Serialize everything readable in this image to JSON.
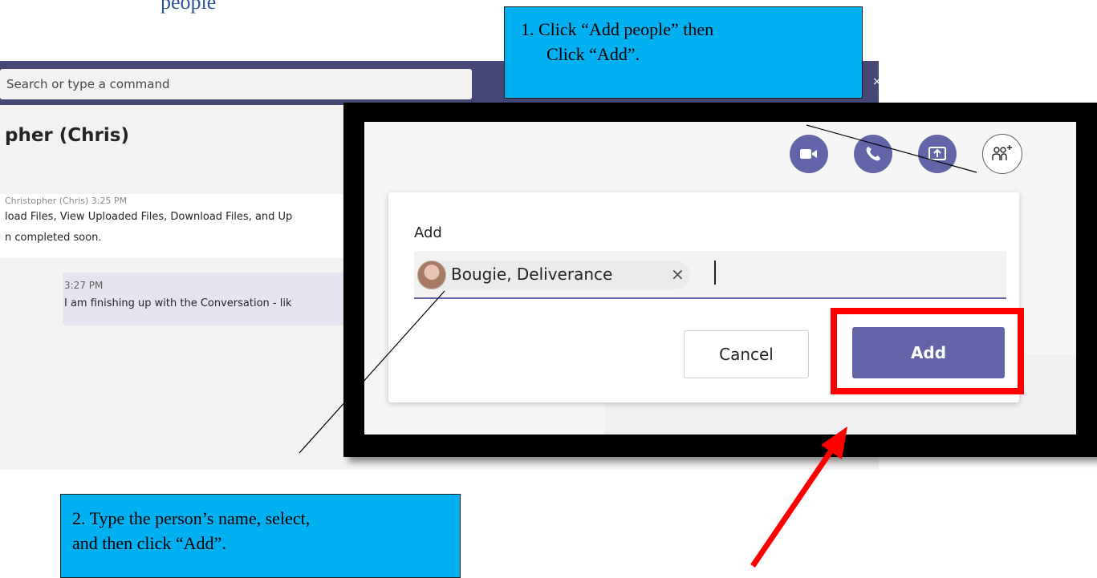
{
  "top_fragment": "people",
  "teams": {
    "search_placeholder": "Search or type a command",
    "close_glyph": "×",
    "chat_title": "pher (Chris)",
    "message_meta": "Christopher (Chris)  3:25 PM",
    "message_line1": "load Files, View Uploaded Files, Download Files, and Up",
    "message_line2": "n completed soon.",
    "my_time": "3:27 PM",
    "my_text": "I am finishing up with the Conversation - lik"
  },
  "dialog": {
    "icons": [
      "video-call-icon",
      "audio-call-icon",
      "share-screen-icon",
      "add-people-icon"
    ],
    "add_label": "Add",
    "chip_name": "Bougie, Deliverance",
    "chip_remove": "×",
    "cancel_label": "Cancel",
    "add_button_label": "Add"
  },
  "callouts": {
    "step1_line1": "1.   Click “Add people” then",
    "step1_line2": "Click “Add”.",
    "step2_line1": "2. Type the person’s name, select,",
    "step2_line2": "and then click “Add”."
  },
  "colors": {
    "teams_purple": "#6264a7",
    "teams_bar": "#464775",
    "callout_blue": "#00b0f0",
    "highlight_red": "#ff0000"
  }
}
